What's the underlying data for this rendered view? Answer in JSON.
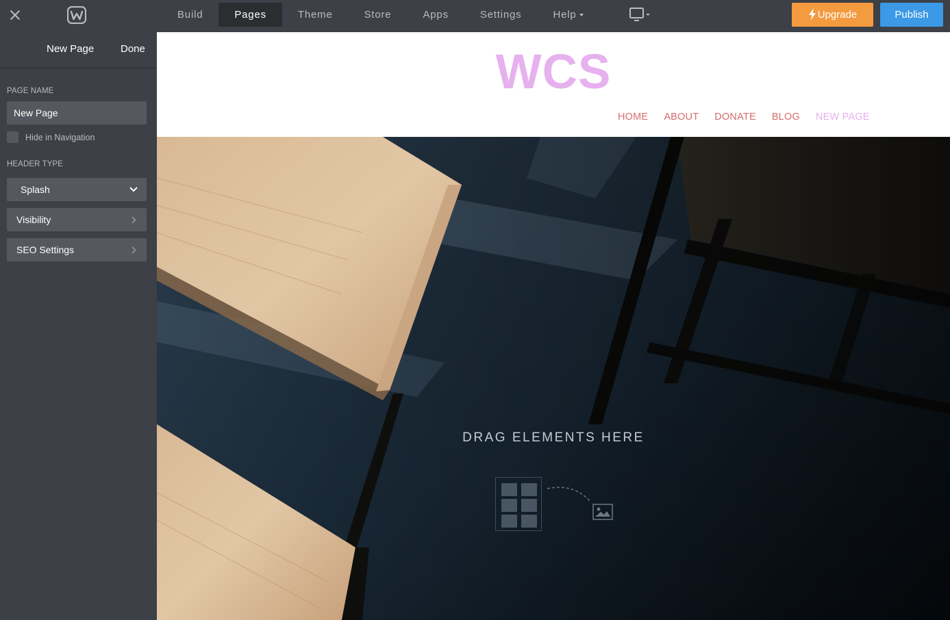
{
  "topbar": {
    "tabs": [
      {
        "label": "Build",
        "active": false
      },
      {
        "label": "Pages",
        "active": true
      },
      {
        "label": "Theme",
        "active": false
      },
      {
        "label": "Store",
        "active": false
      },
      {
        "label": "Apps",
        "active": false
      },
      {
        "label": "Settings",
        "active": false
      }
    ],
    "help_label": "Help",
    "upgrade_label": "Upgrade",
    "publish_label": "Publish",
    "colors": {
      "upgrade": "#f49a3f",
      "publish": "#3b99e6",
      "bar": "#3d4046"
    }
  },
  "sidebar": {
    "title": "New Page",
    "done_label": "Done",
    "page_name_label": "PAGE NAME",
    "page_name_value": "New Page",
    "hide_nav_label": "Hide in Navigation",
    "hide_nav_checked": false,
    "header_type_label": "HEADER TYPE",
    "header_type_value": "Splash",
    "visibility_label": "Visibility",
    "seo_label": "SEO Settings"
  },
  "site": {
    "logo_text": "WCS",
    "nav": [
      {
        "label": "HOME",
        "current": false
      },
      {
        "label": "ABOUT",
        "current": false
      },
      {
        "label": "DONATE",
        "current": false
      },
      {
        "label": "BLOG",
        "current": false
      },
      {
        "label": "NEW PAGE",
        "current": true
      }
    ],
    "colors": {
      "logo": "#e6b1ee",
      "nav": "#d56c6c",
      "nav_current": "#e6b1ee"
    },
    "drag_text": "DRAG ELEMENTS HERE"
  }
}
